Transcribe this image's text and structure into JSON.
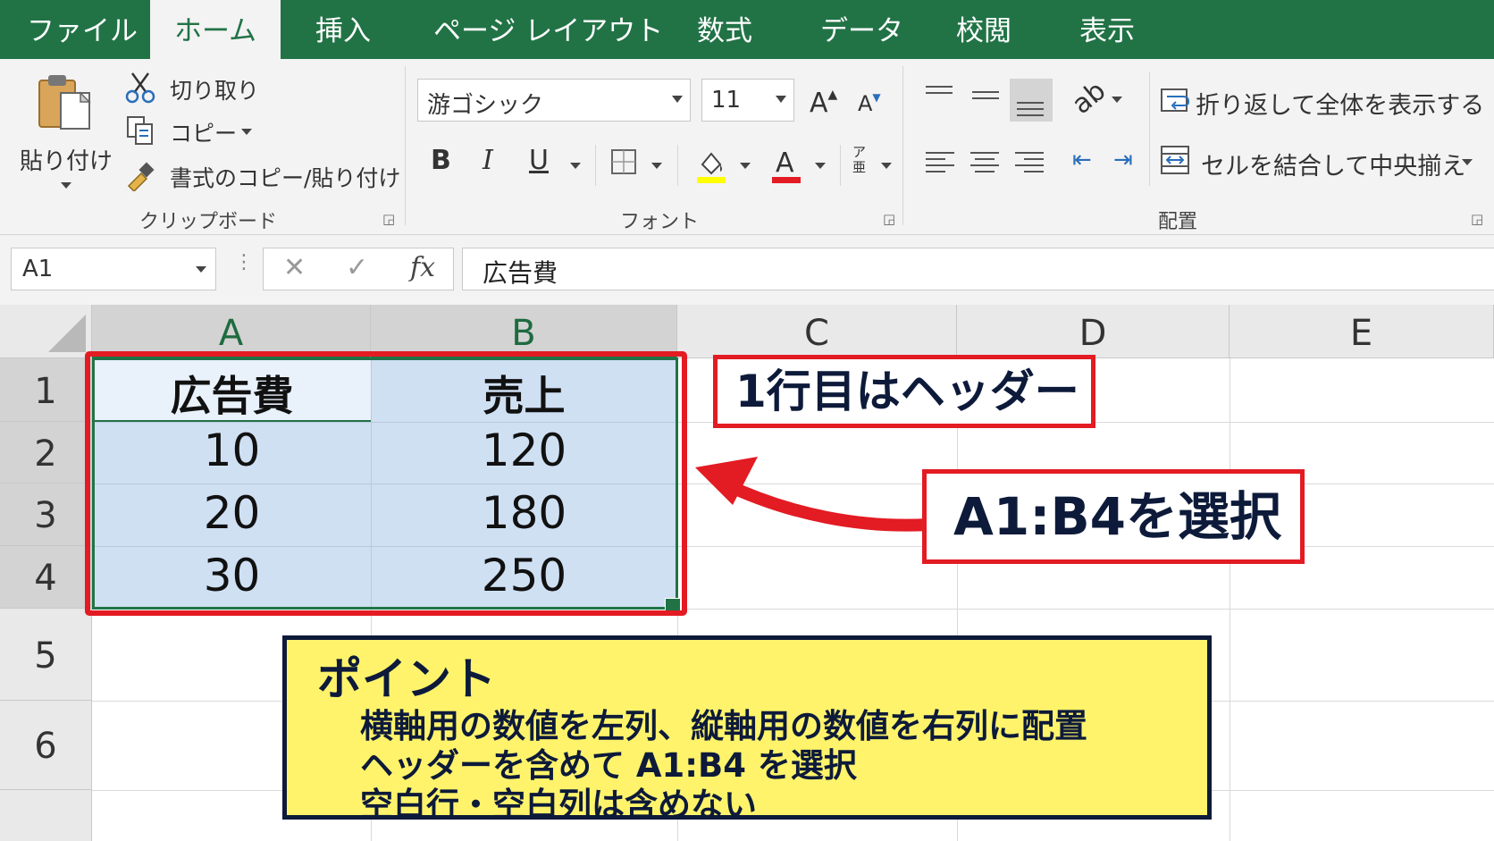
{
  "tabs": [
    "ファイル",
    "ホーム",
    "挿入",
    "ページ レイアウト",
    "数式",
    "データ",
    "校閲",
    "表示"
  ],
  "active_tab": "ホーム",
  "clipboard": {
    "paste_label": "貼り付け",
    "cut_label": "切り取り",
    "copy_label": "コピー",
    "format_painter_label": "書式のコピー/貼り付け",
    "group_label": "クリップボード"
  },
  "font": {
    "font_name": "游ゴシック",
    "font_size": "11",
    "bold": "B",
    "italic": "I",
    "underline": "U",
    "group_label": "フォント"
  },
  "alignment": {
    "wrap_text_label": "折り返して全体を表示する",
    "merge_center_label": "セルを結合して中央揃え",
    "group_label": "配置"
  },
  "formula_bar": {
    "name_box": "A1",
    "fx": "fx",
    "content": "広告費"
  },
  "columns": [
    "A",
    "B",
    "C",
    "D",
    "E"
  ],
  "rows": [
    "1",
    "2",
    "3",
    "4",
    "5",
    "6"
  ],
  "cells": {
    "A1": "広告費",
    "B1": "売上",
    "A2": "10",
    "B2": "120",
    "A3": "20",
    "B3": "180",
    "A4": "30",
    "B4": "250"
  },
  "annotations": {
    "header_note": "1行目はヘッダー",
    "select_note": "A1:B4を選択",
    "point_title": "ポイント",
    "point_lines": [
      "横軸用の数値を左列、縦軸用の数値を右列に配置",
      "ヘッダーを含めて A1:B4 を選択",
      "空白行・空白列は含めない"
    ]
  },
  "colors": {
    "excel_green": "#217346",
    "selection_fill": "#cfe0f3",
    "callout_red": "#e31b23",
    "note_yellow": "#fef36b",
    "note_navy": "#0d1a3a"
  }
}
